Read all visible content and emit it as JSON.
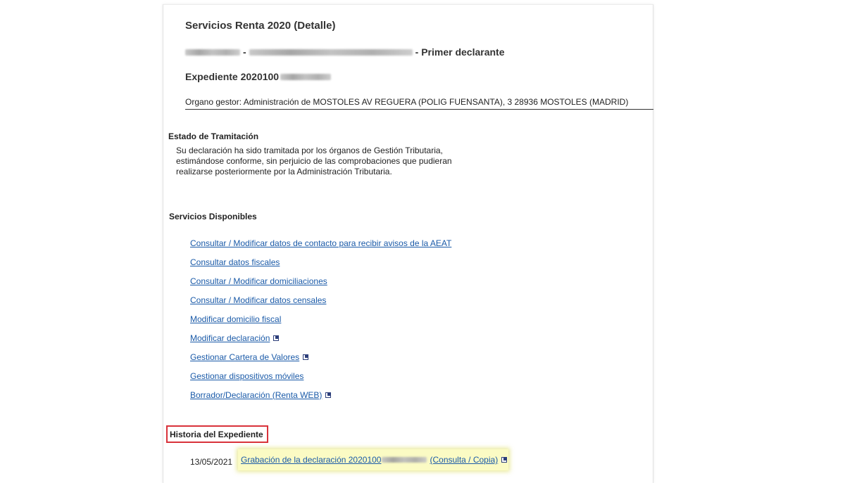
{
  "page": {
    "title": "Servicios Renta 2020 (Detalle)",
    "declarant_role": "- Primer declarante",
    "declarant_separator": "-",
    "expediente_prefix": "Expediente 2020100",
    "organo_gestor": "Organo gestor: Administración de MOSTOLES  AV REGUERA (POLIG FUENSANTA), 3 28936 MOSTOLES (MADRID)"
  },
  "estado": {
    "heading": "Estado de Tramitación",
    "lines": [
      "Su declaración ha sido tramitada por los órganos de Gestión Tributaria,",
      "estimándose conforme, sin perjuicio de las comprobaciones que pudieran",
      "realizarse posteriormente por la Administración Tributaria."
    ]
  },
  "servicios": {
    "heading": "Servicios Disponibles",
    "links": [
      {
        "label": "Consultar / Modificar datos de contacto para recibir avisos de la AEAT",
        "external": false
      },
      {
        "label": "Consultar datos fiscales",
        "external": false
      },
      {
        "label": "Consultar / Modificar domiciliaciones",
        "external": false
      },
      {
        "label": "Consultar / Modificar datos censales",
        "external": false
      },
      {
        "label": "Modificar domicilio fiscal",
        "external": false
      },
      {
        "label": "Modificar declaración",
        "external": true
      },
      {
        "label": "Gestionar Cartera de Valores",
        "external": true
      },
      {
        "label": "Gestionar dispositivos móviles",
        "external": false
      },
      {
        "label": "Borrador/Declaración (Renta WEB)",
        "external": true
      }
    ]
  },
  "historia": {
    "heading": "Historia del Expediente",
    "entries": [
      {
        "date": "13/05/2021",
        "label_prefix": "Grabación de la declaración 2020100",
        "label_suffix": "(Consulta / Copia)",
        "external": true
      }
    ]
  },
  "colors": {
    "link": "#1a5aa8",
    "highlight_box_border": "#d9323a",
    "highlight_entry_bg": "#fbfbc4"
  },
  "icons": {
    "external_link": "external-link-icon"
  }
}
